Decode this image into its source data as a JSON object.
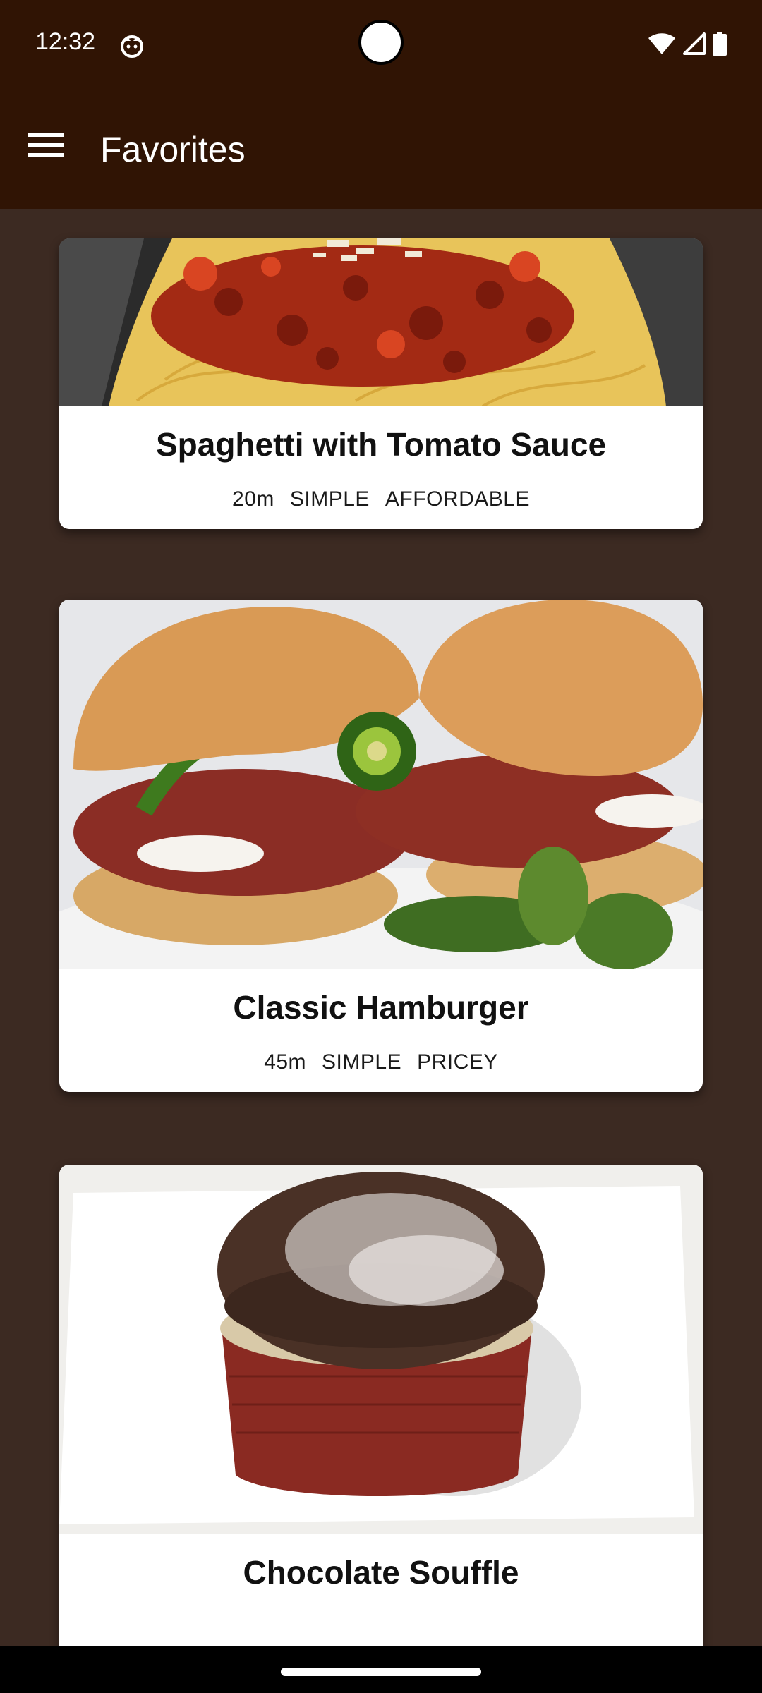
{
  "status_bar": {
    "time": "12:32"
  },
  "toolbar": {
    "title": "Favorites",
    "menu_icon": "hamburger-menu-icon"
  },
  "colors": {
    "appbar": "#301404",
    "background": "#3c2a22",
    "card": "#ffffff"
  },
  "meals": [
    {
      "title": "Spaghetti with Tomato Sauce",
      "duration": "20m",
      "complexity": "SIMPLE",
      "affordability": "AFFORDABLE",
      "image": "spaghetti-photo"
    },
    {
      "title": "Classic Hamburger",
      "duration": "45m",
      "complexity": "SIMPLE",
      "affordability": "PRICEY",
      "image": "hamburger-photo"
    },
    {
      "title": "Chocolate Souffle",
      "image": "chocolate-souffle-photo"
    }
  ]
}
